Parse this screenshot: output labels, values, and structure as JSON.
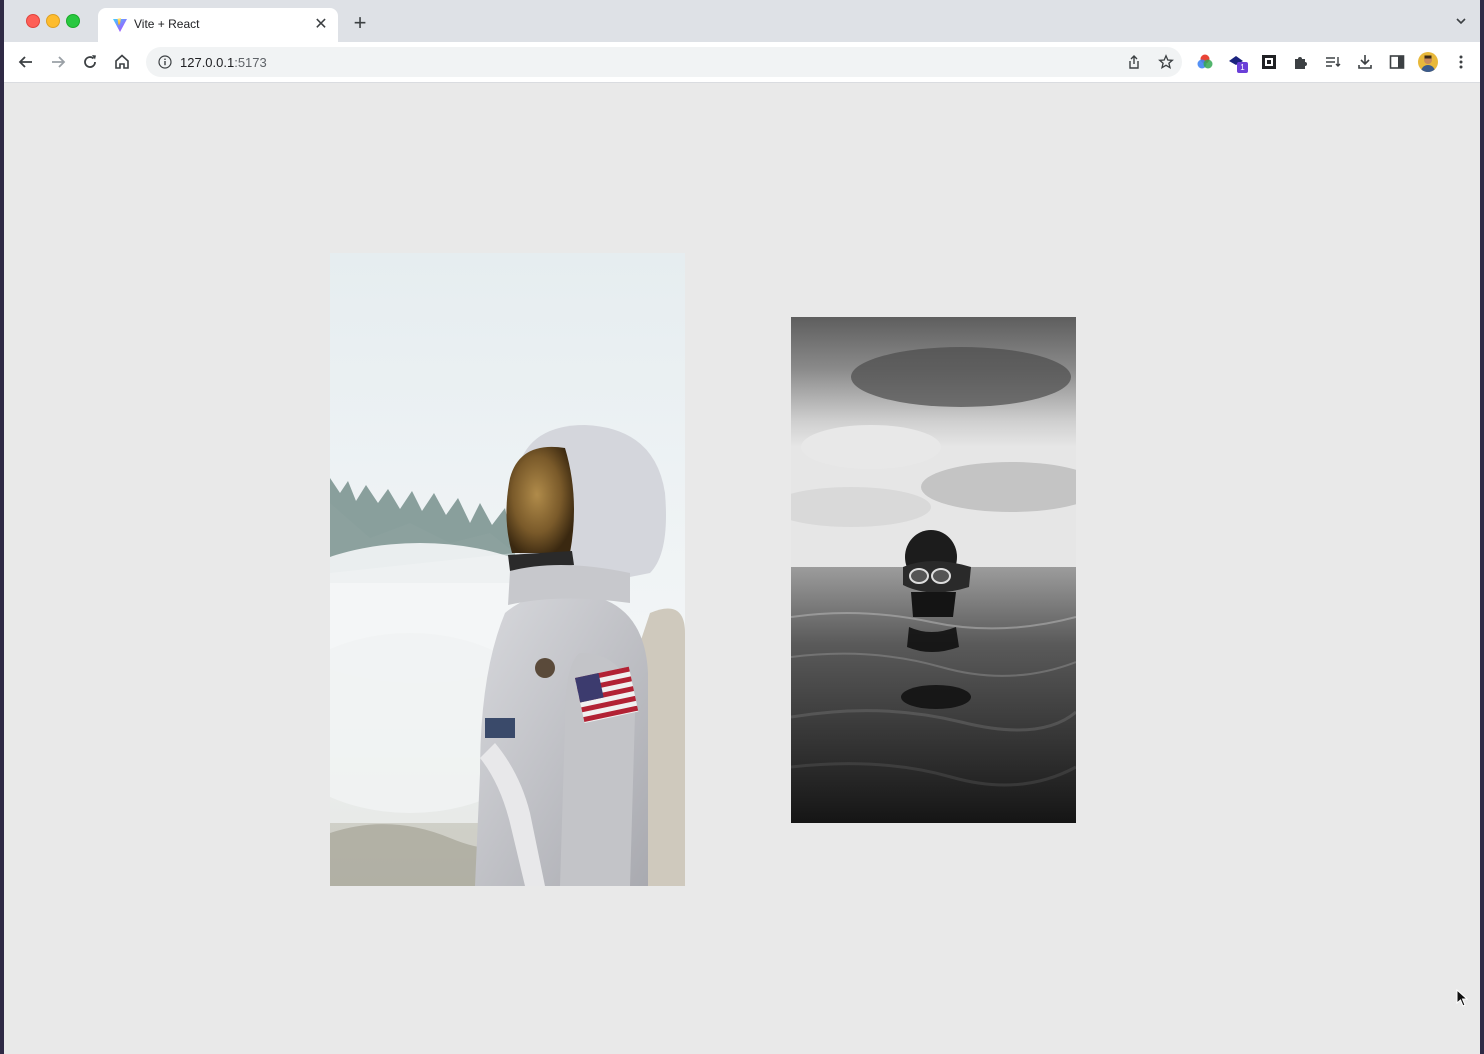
{
  "browser": {
    "tab": {
      "title": "Vite + React",
      "favicon": "vite-logo-icon",
      "close_icon": "close-icon"
    },
    "new_tab_icon": "plus-icon",
    "tab_search_icon": "chevron-down-icon",
    "nav": {
      "back_icon": "back-arrow-icon",
      "forward_icon": "forward-arrow-icon",
      "reload_icon": "reload-icon",
      "home_icon": "home-icon"
    },
    "address_bar": {
      "site_info_icon": "info-icon",
      "url_host": "127.0.0.1",
      "url_port": ":5173"
    },
    "toolbar_icons": [
      "share-icon",
      "bookmark-star-icon",
      "color-extension-icon",
      "extension-badge-icon",
      "frame-extension-icon",
      "puzzle-extensions-icon",
      "reading-list-icon",
      "download-icon",
      "side-panel-icon",
      "profile-avatar",
      "menu-icon"
    ],
    "extension_badge_count": "1"
  },
  "page": {
    "background": "#e9e9e9",
    "images": [
      {
        "name": "astronaut-photo",
        "description": "astronaut-in-white-spacesuit"
      },
      {
        "name": "diver-photo",
        "description": "diver-in-water-black-and-white"
      }
    ]
  }
}
